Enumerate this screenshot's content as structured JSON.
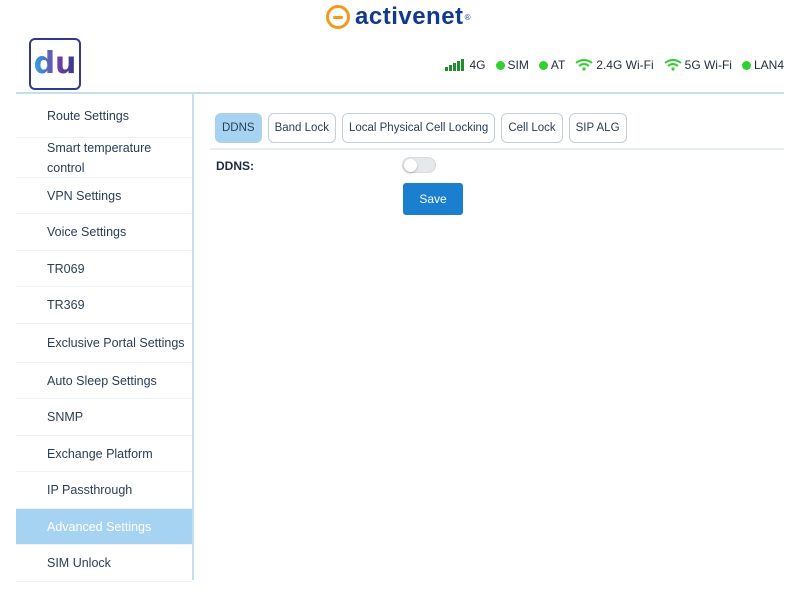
{
  "brand": {
    "name": "activenet",
    "tm": "®"
  },
  "logo": {
    "text": "du"
  },
  "status": {
    "network": "4G",
    "sim": "SIM",
    "at": "AT",
    "wifi24": "2.4G Wi-Fi",
    "wifi5": "5G Wi-Fi",
    "lan": "LAN4",
    "colors": {
      "ok": "#2ed12e",
      "signal": "#1f8e2f"
    }
  },
  "sidebar": {
    "items": [
      {
        "label": "Route Settings"
      },
      {
        "label": "Smart temperature control"
      },
      {
        "label": "VPN Settings"
      },
      {
        "label": "Voice Settings"
      },
      {
        "label": "TR069"
      },
      {
        "label": "TR369"
      },
      {
        "label": "Exclusive Portal Settings"
      },
      {
        "label": "Auto Sleep Settings"
      },
      {
        "label": "SNMP"
      },
      {
        "label": "Exchange Platform"
      },
      {
        "label": "IP Passthrough"
      },
      {
        "label": "Advanced Settings",
        "active": true
      },
      {
        "label": "SIM Unlock"
      }
    ]
  },
  "tabs": [
    {
      "label": "DDNS",
      "active": true
    },
    {
      "label": "Band Lock"
    },
    {
      "label": "Local Physical Cell Locking"
    },
    {
      "label": "Cell Lock"
    },
    {
      "label": "SIP ALG"
    }
  ],
  "form": {
    "ddns_label": "DDNS:",
    "ddns_enabled": false,
    "save_label": "Save"
  },
  "colors": {
    "accent": "#1a7fcf",
    "active_bg": "#a7d3f3"
  }
}
